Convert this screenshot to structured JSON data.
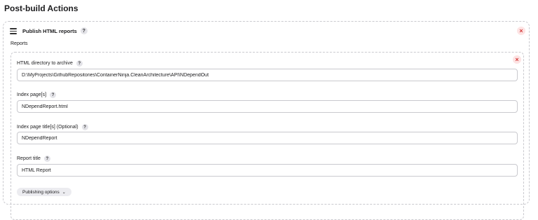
{
  "section": {
    "title": "Post-build Actions"
  },
  "step": {
    "title": "Publish HTML reports",
    "help": "?",
    "delete": "×",
    "reports_label": "Reports"
  },
  "report": {
    "delete": "×",
    "fields": {
      "dir": {
        "label": "HTML directory to archive",
        "help": "?",
        "value": "D:\\MyProjects\\GithubRepositories\\ContainerNinja.CleanArchitecture\\API\\NDependOut"
      },
      "index": {
        "label": "Index page[s]",
        "help": "?",
        "value": "NDependReport.html"
      },
      "index_title": {
        "label": "Index page title[s] (Optional)",
        "help": "?",
        "value": "NDependReport"
      },
      "report_title": {
        "label": "Report title",
        "help": "?",
        "value": "HTML Report"
      }
    },
    "publishing_options": "Publishing options",
    "chevron": "⌄"
  },
  "icons": {
    "drag": "drag-handle-icon",
    "help": "help-icon",
    "delete": "delete-icon",
    "chevron": "chevron-down-icon"
  }
}
